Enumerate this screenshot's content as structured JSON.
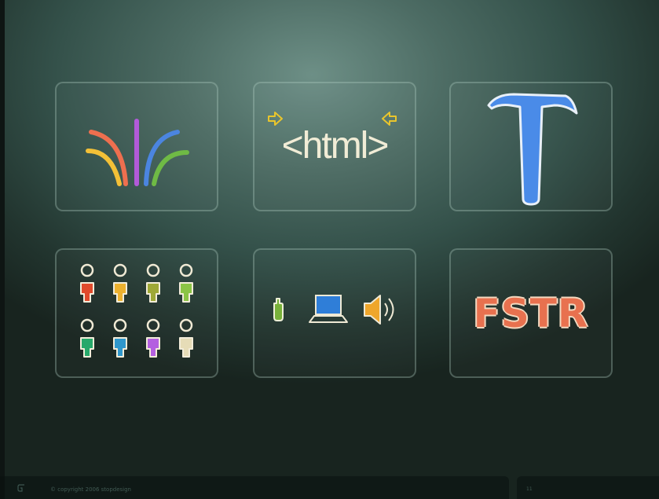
{
  "slide": {
    "tiles": [
      {
        "name": "rainbow-arcs",
        "icon": "rainbow-arcs-icon"
      },
      {
        "name": "html-tag",
        "text": "<html>",
        "icon": "inward-arrows-icon"
      },
      {
        "name": "hammer",
        "icon": "hammer-icon"
      },
      {
        "name": "people-grid",
        "icon": "people-icon"
      },
      {
        "name": "devices",
        "icons": [
          "mobile-phone-icon",
          "laptop-icon",
          "speaker-icon"
        ]
      },
      {
        "name": "fstr",
        "text": "FSTR"
      }
    ],
    "people_colors": [
      "#e04a2c",
      "#ecb12f",
      "#9ea836",
      "#8bc445",
      "#27a86a",
      "#2f97cc",
      "#b45fe0",
      "#e6dcb7"
    ],
    "arc_colors": [
      "#f3c037",
      "#ee6f4f",
      "#b25ad9",
      "#4b85e0",
      "#6fba45"
    ]
  },
  "footer": {
    "copyright": "© copyright 2006 stopdesign",
    "page_number": "11"
  }
}
